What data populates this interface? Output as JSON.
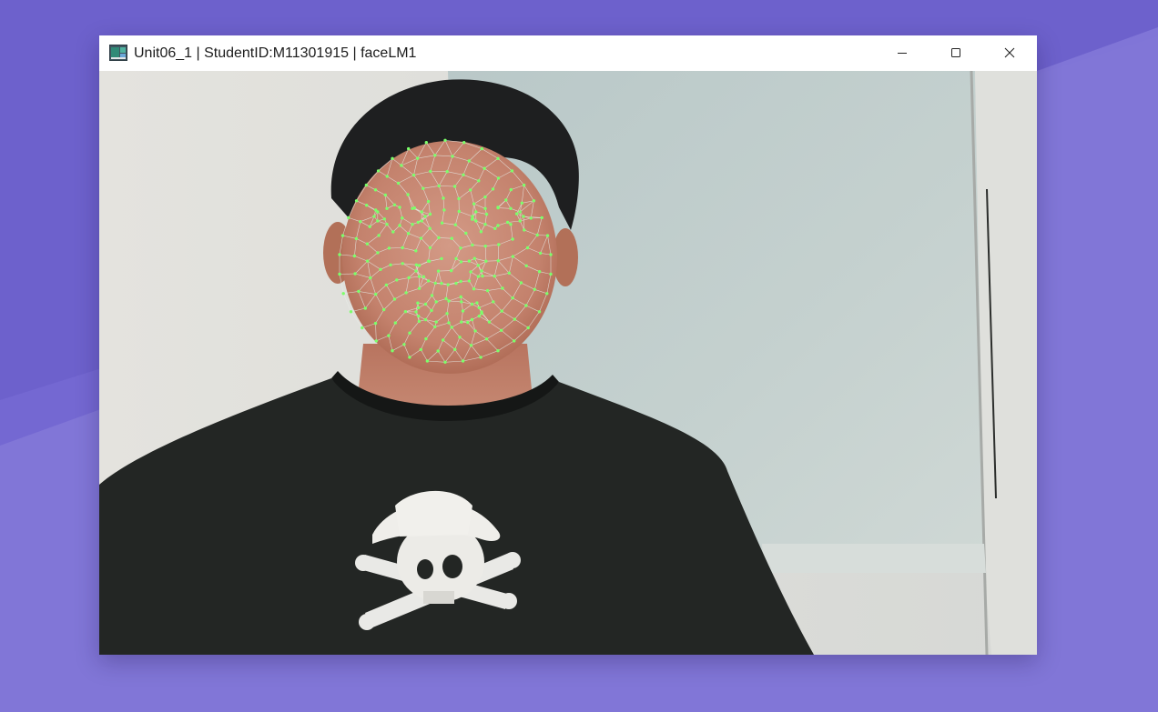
{
  "window": {
    "title": "Unit06_1 | StudentID:M11301915 | faceLM1",
    "controls": {
      "minimize_icon": "minimize-icon",
      "maximize_icon": "maximize-icon",
      "close_icon": "close-icon"
    }
  },
  "camera_feed": {
    "overlay": "face-landmark-mesh",
    "landmark_color": "#7cff6a",
    "mesh_color": "#e8ece8"
  },
  "desktop": {
    "wallpaper_colors": [
      "#6f63cf",
      "#8a7fd6"
    ]
  }
}
